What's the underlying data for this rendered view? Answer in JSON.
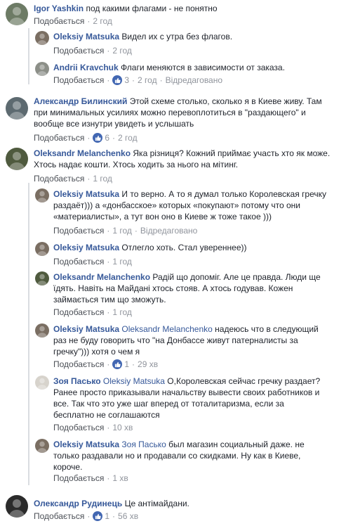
{
  "like_label": "Подобається",
  "edited_label": "Відредаговано",
  "comments": [
    {
      "author": "Igor Yashkin",
      "text": "под какими флагами - не понятно",
      "time": "2 год",
      "avatar_color": "#6d7b65"
    },
    {
      "author": "Oleksiy Matsuka",
      "text": "Видел их с утра без флагов.",
      "time": "2 год",
      "avatar_color": "#7a6e62"
    },
    {
      "author": "Andrii Kravchuk",
      "text": "Флаги меняются в зависимости от заказа.",
      "time": "2 год",
      "likes": "3",
      "avatar_color": "#8c8f88"
    },
    {
      "author": "Александр Билинский",
      "text_lines": [
        "Этой схеме столько, сколько я в Киеве живу. Там",
        "при минимальных усилиях можно перевоплотиться в \"раздающего\" и",
        "вообще все изнутри увидеть и услышать"
      ],
      "time": "2 год",
      "likes": "6",
      "avatar_color": "#5d6a70"
    },
    {
      "author": "Oleksandr Melanchenko",
      "text_lines": [
        "Яка різниця? Кожний приймає участь хто як може.",
        "Хтось надає кошти. Хтось ходить за нього на мітинг."
      ],
      "time": "1 год",
      "avatar_color": "#4f5a3e"
    },
    {
      "author": "Oleksiy Matsuka",
      "text_lines": [
        "И то верно. А то я думал только Королевская гречку",
        "раздаёт))) а «донбасское» которых «покупают» потому что они",
        "«материалисты», а тут вон оно в Киеве ж тоже такое )))"
      ],
      "time": "1 год",
      "avatar_color": "#7a6e62"
    },
    {
      "author": "Oleksiy Matsuka",
      "text": "Отлегло хоть. Стал увереннее))",
      "time": "1 год",
      "avatar_color": "#7a6e62"
    },
    {
      "author": "Oleksandr Melanchenko",
      "text_lines": [
        "Радій що допоміг. Але це правда. Люди ще",
        "їдять. Навіть на Майдані хтось стояв. А хтось годував. Кожен",
        "займається тим що зможуть."
      ],
      "time": "1 год",
      "avatar_color": "#4f5a3e"
    },
    {
      "author": "Oleksiy Matsuka",
      "mention": "Oleksandr Melanchenko",
      "text_lines": [
        "надеюсь что в следующий",
        "раз не буду говорить что \"на Донбассе живут патерналисты за",
        "гречку\"))) хотя о чем я"
      ],
      "time": "29 хв",
      "likes": "1",
      "avatar_color": "#7a6e62"
    },
    {
      "author": "Зоя Пасько",
      "mention": "Oleksiy Matsuka",
      "text_lines": [
        "О,Королевская сейчас гречку раздает?",
        "Ранее просто приказывали начальству вывести своих работников и",
        "все. Так что это уже шаг вперед от тоталитаризма, если за",
        "бесплатно не соглашаются"
      ],
      "time": "10 хв",
      "avatar_color": "#d7d3cc"
    },
    {
      "author": "Oleksiy Matsuka",
      "mention": "Зоя Пасько",
      "text_lines": [
        "был магазин социальный даже. не",
        "только раздавали но и продавали со скидками. Ну как в Киеве,",
        "короче."
      ],
      "time": "1 хв",
      "avatar_color": "#7a6e62"
    },
    {
      "author": "Олександр Рудинець",
      "text": "Це антімайдани.",
      "time": "56 хв",
      "likes": "1",
      "avatar_color": "#2b2b2b"
    }
  ]
}
